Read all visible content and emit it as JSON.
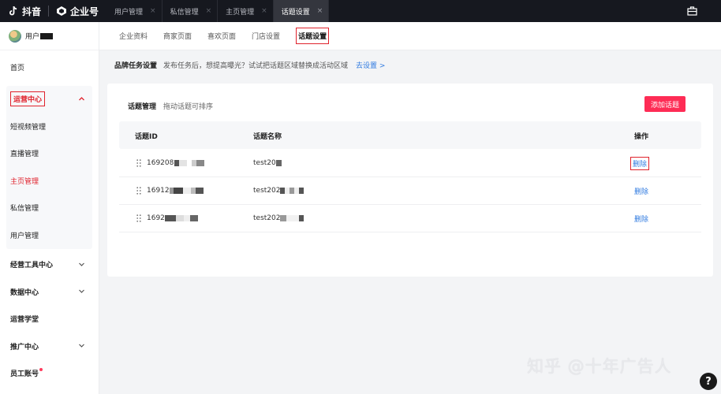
{
  "topbar": {
    "brand_name": "抖音",
    "biz_name": "企业号",
    "tabs": [
      {
        "label": "用户管理",
        "active": false
      },
      {
        "label": "私信管理",
        "active": false
      },
      {
        "label": "主页管理",
        "active": false
      },
      {
        "label": "话题设置",
        "active": true
      }
    ],
    "close_glyph": "×",
    "right_icon": "toolbox-icon"
  },
  "user": {
    "name": "用户"
  },
  "sidebar": {
    "home": "首页",
    "ops_center": "运营中心",
    "ops_items": [
      "短视频管理",
      "直播管理",
      "主页管理",
      "私信管理",
      "用户管理"
    ],
    "ops_current": "主页管理",
    "groups": [
      {
        "label": "经营工具中心",
        "expandable": true
      },
      {
        "label": "数据中心",
        "expandable": true
      },
      {
        "label": "运营学堂",
        "expandable": false
      },
      {
        "label": "推广中心",
        "expandable": true
      },
      {
        "label": "员工账号",
        "expandable": false,
        "badge": true
      }
    ]
  },
  "subnav": {
    "tabs": [
      "企业资料",
      "商家页面",
      "喜欢页面",
      "门店设置",
      "话题设置"
    ],
    "active": "话题设置"
  },
  "notice": {
    "title": "品牌任务设置",
    "desc": "发布任务后，想提高曝光？试试把话题区域替换成活动区域",
    "link": "去设置 >"
  },
  "topic_card": {
    "title": "话题管理",
    "hint": "拖动话题可排序",
    "add_button": "添加话题",
    "columns": {
      "id": "话题ID",
      "name": "话题名称",
      "action": "操作"
    },
    "rows": [
      {
        "id": "169208",
        "name": "test20",
        "action": "删除"
      },
      {
        "id": "16912",
        "name": "test202",
        "action": "删除"
      },
      {
        "id": "1692",
        "name": "test202",
        "action": "删除"
      }
    ]
  },
  "watermark": "知乎 @十年广告人",
  "help_glyph": "?"
}
